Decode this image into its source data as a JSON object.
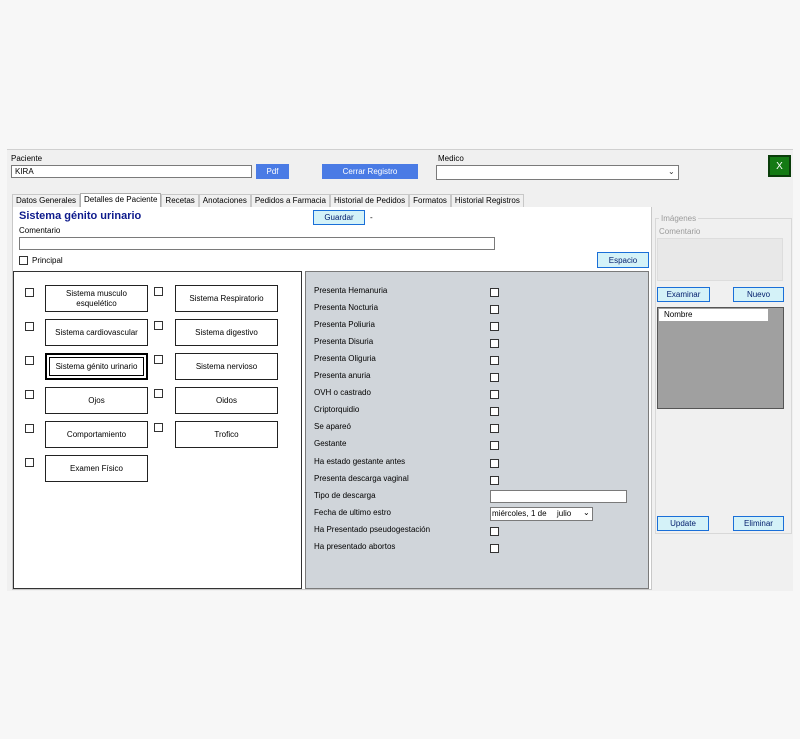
{
  "header": {
    "paciente_label": "Paciente",
    "paciente_value": "KIRA",
    "pdf_button": "Pdf",
    "cerrar_button": "Cerrar Registro",
    "medico_label": "Medico",
    "medico_value": "",
    "close_button": "X"
  },
  "tabs": [
    {
      "label": "Datos Generales",
      "active": false
    },
    {
      "label": "Detalles de Paciente",
      "active": true
    },
    {
      "label": "Recetas",
      "active": false
    },
    {
      "label": "Anotaciones",
      "active": false
    },
    {
      "label": "Pedidos a Farmacia",
      "active": false
    },
    {
      "label": "Historial de Pedidos",
      "active": false
    },
    {
      "label": "Formatos",
      "active": false
    },
    {
      "label": "Historial Registros",
      "active": false
    }
  ],
  "detail": {
    "section_title": "Sistema génito urinario",
    "guardar_button": "Guardar",
    "dash": "-",
    "comentario_label": "Comentario",
    "comentario_value": "",
    "principal_label": "Principal",
    "espacio_button": "Espacio"
  },
  "systems": [
    {
      "label": "Sistema musculo esquelético"
    },
    {
      "label": "Sistema Respiratorio"
    },
    {
      "label": "Sistema cardiovascular"
    },
    {
      "label": "Sistema digestivo"
    },
    {
      "label": "Sistema génito urinario"
    },
    {
      "label": "Sistema nervioso"
    },
    {
      "label": "Ojos"
    },
    {
      "label": "Oidos"
    },
    {
      "label": "Comportamiento"
    },
    {
      "label": "Trofico"
    },
    {
      "label": "Examen Físico"
    }
  ],
  "questions": [
    {
      "label": "Presenta Hemanuria"
    },
    {
      "label": "Presenta Nocturia"
    },
    {
      "label": "Presenta Poliuria"
    },
    {
      "label": "Presenta Disuria"
    },
    {
      "label": "Presenta Oliguria"
    },
    {
      "label": "Presenta anuria"
    },
    {
      "label": "OVH o castrado"
    },
    {
      "label": "Criptorquidio"
    },
    {
      "label": "Se apareó"
    },
    {
      "label": "Gestante"
    },
    {
      "label": "Ha estado gestante antes"
    },
    {
      "label": "Presenta descarga vaginal"
    }
  ],
  "tipo_descarga": {
    "label": "Tipo de descarga",
    "value": ""
  },
  "fecha_estro": {
    "label": "Fecha de ultimo estro",
    "weekday": "miércoles,",
    "day": "1 de",
    "month": "julio"
  },
  "tail_questions": [
    {
      "label": "Ha Presentado pseudogestación"
    },
    {
      "label": "Ha presentado abortos"
    }
  ],
  "images": {
    "group_label": "Imágenes",
    "comentario_label": "Comentario",
    "examinar_button": "Examinar",
    "nuevo_button": "Nuevo",
    "list_header": "Nombre",
    "update_button": "Update",
    "eliminar_button": "Eliminar"
  },
  "colors": {
    "accent_blue": "#4a7be5",
    "title_navy": "#0d1a8c",
    "close_green": "#147a14"
  }
}
